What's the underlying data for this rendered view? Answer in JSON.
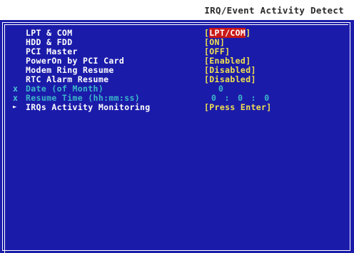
{
  "header": {
    "title": "IRQ/Event Activity Detect"
  },
  "items": [
    {
      "marker": "",
      "label": "LPT & COM",
      "value_open": "[",
      "value": "LPT/COM",
      "value_close": "]"
    },
    {
      "marker": "",
      "label": "HDD & FDD",
      "value_open": "[",
      "value": "ON",
      "value_close": "]"
    },
    {
      "marker": "",
      "label": "PCI Master",
      "value_open": "[",
      "value": "OFF",
      "value_close": "]"
    },
    {
      "marker": "",
      "label": "PowerOn by PCI Card",
      "value_open": "[",
      "value": "Enabled",
      "value_close": "]"
    },
    {
      "marker": "",
      "label": "Modem Ring Resume",
      "value_open": "[",
      "value": "Disabled",
      "value_close": "]"
    },
    {
      "marker": "",
      "label": "RTC Alarm Resume",
      "value_open": "[",
      "value": "Disabled",
      "value_close": "]"
    },
    {
      "marker": "x",
      "label": "Date (of Month)",
      "value": "0"
    },
    {
      "marker": "x",
      "label": "Resume Time (hh:mm:ss)",
      "value": "0 : 0 : 0"
    },
    {
      "marker": "►",
      "label": "IRQs Activity Monitoring",
      "value": "[Press Enter]"
    }
  ],
  "colors": {
    "panel_bg": "#1b1baa",
    "label": "#ffffff",
    "value": "#f0e050",
    "disabled": "#3cb8c8",
    "highlight_bg": "#c81818"
  }
}
